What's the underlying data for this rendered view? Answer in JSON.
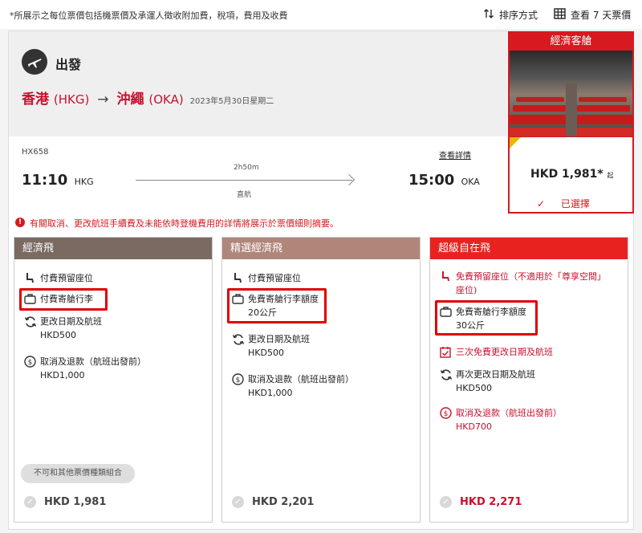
{
  "topbar": {
    "note": "*所展示之每位票價包括機票價及承運人徵收附加費，稅項，費用及收費",
    "sort_label": "排序方式",
    "week_label": "查看 7 天票價"
  },
  "header": {
    "depart_label": "出發",
    "origin_city": "香港",
    "origin_code": "(HKG)",
    "dest_city": "沖繩",
    "dest_code": "(OKA)",
    "date": "2023年5月30日星期二",
    "cabin_label": "經濟客艙"
  },
  "flight": {
    "number": "HX658",
    "depart_time": "11:10",
    "depart_airport": "HKG",
    "duration": "2h50m",
    "stops": "直航",
    "details_link": "查看詳情",
    "arrive_time": "15:00",
    "arrive_airport": "OKA"
  },
  "selected_price": {
    "amount": "HKD 1,981*",
    "from": "起",
    "selected_label": "已選擇"
  },
  "warning": "有關取消、更改航班手續費及未能依時登機費用的詳情將展示於票價細則摘要。",
  "fares": [
    {
      "name": "經濟飛",
      "color": "#7a6a62",
      "items": [
        {
          "icon": "seat-icon",
          "text": "付費預留座位",
          "sub": ""
        },
        {
          "icon": "baggage-icon",
          "text": "付費寄艙行李",
          "sub": ""
        },
        {
          "icon": "change-icon",
          "text": "更改日期及航班",
          "sub": "HKD500"
        },
        {
          "icon": "refund-icon",
          "text": "取消及退款（航班出發前）",
          "sub": "HKD1,000"
        }
      ],
      "combo_label": "不可和其他票價種類組合",
      "price": "HKD 1,981"
    },
    {
      "name": "精選經濟飛",
      "color": "#b0867a",
      "items": [
        {
          "icon": "seat-icon",
          "text": "付費預留座位",
          "sub": ""
        },
        {
          "icon": "baggage-icon",
          "text": "免費寄艙行李額度",
          "sub": "20公斤"
        },
        {
          "icon": "change-icon",
          "text": "更改日期及航班",
          "sub": "HKD500"
        },
        {
          "icon": "refund-icon",
          "text": "取消及退款（航班出發前）",
          "sub": "HKD1,000"
        }
      ],
      "price": "HKD 2,201"
    },
    {
      "name": "超級自在飛",
      "color": "#e8231f",
      "items": [
        {
          "icon": "seat-icon",
          "text": "免費預留座位（不適用於「尊享空間」",
          "sub": "座位)"
        },
        {
          "icon": "baggage-icon",
          "text": "免費寄艙行李額度",
          "sub": "30公斤"
        },
        {
          "icon": "calendar-icon",
          "text": "三次免費更改日期及航班",
          "sub": ""
        },
        {
          "icon": "change-icon",
          "text": "再次更改日期及航班",
          "sub": "HKD500"
        },
        {
          "icon": "refund-icon",
          "text": "取消及退款（航班出發前）",
          "sub": "HKD700"
        }
      ],
      "price": "HKD 2,271"
    }
  ]
}
